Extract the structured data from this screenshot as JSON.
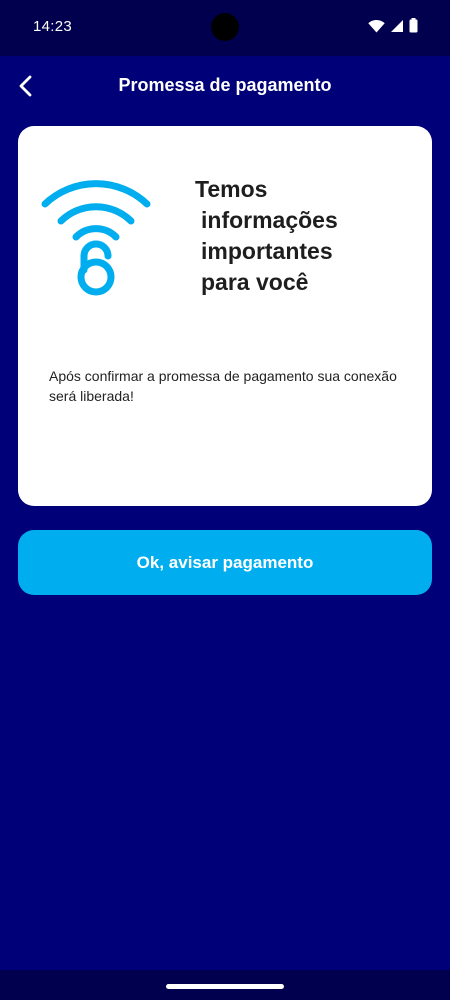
{
  "status_bar": {
    "time": "14:23",
    "icons": [
      "wifi-icon",
      "signal-icon",
      "battery-icon"
    ]
  },
  "app_bar": {
    "title": "Promessa de pagamento",
    "back_icon": "chevron-left-icon"
  },
  "card": {
    "icon": "wifi-unlock-icon",
    "heading_lines": [
      "Temos",
      "informações",
      "importantes",
      "para você"
    ],
    "message": "Após confirmar a promessa de pagamento sua conexão será liberada!"
  },
  "primary_button": {
    "label": "Ok, avisar pagamento"
  },
  "colors": {
    "background": "#000078",
    "status_bar": "#00004f",
    "accent": "#00aeef",
    "card": "#ffffff",
    "heading_text": "#1e1e1e"
  }
}
